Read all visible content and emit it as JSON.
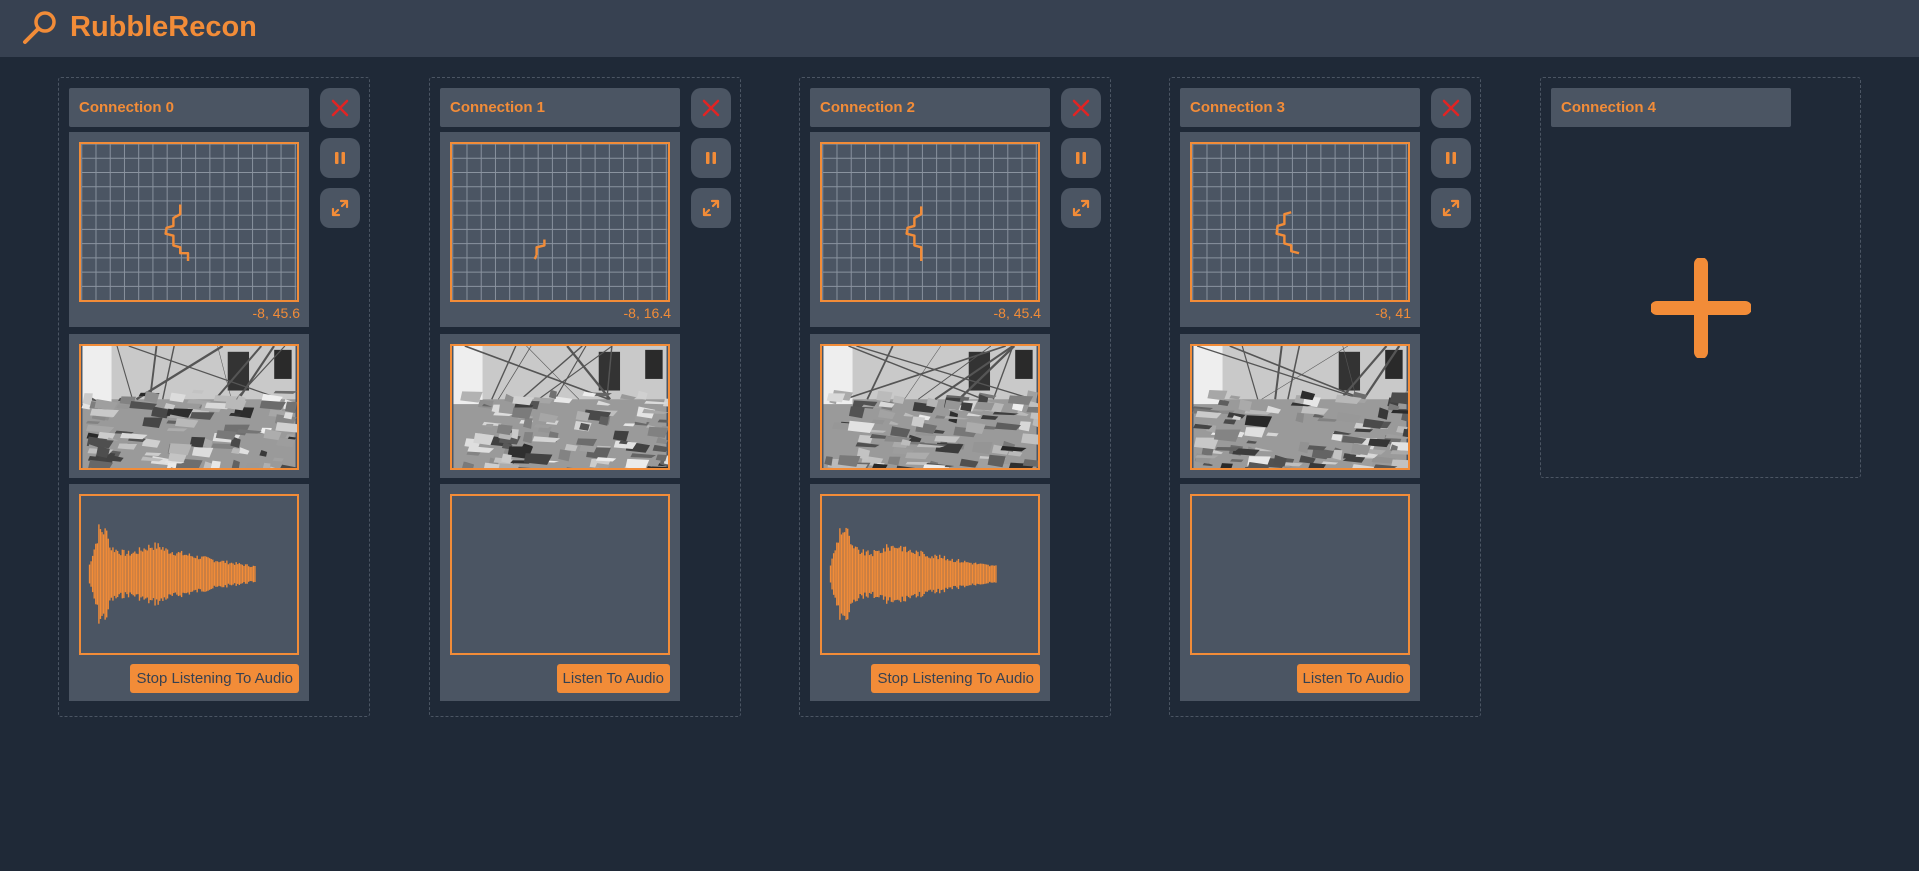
{
  "app": {
    "title": "RubbleRecon",
    "logo_icon": "magnifier-icon",
    "accent_color": "#f28c38",
    "danger_color": "#e02424"
  },
  "connections": [
    {
      "title": "Connection 0",
      "coords": "-8, 45.6",
      "audio_button": "Stop Listening To Audio",
      "audio_active": true
    },
    {
      "title": "Connection 1",
      "coords": "-8, 16.4",
      "audio_button": "Listen To Audio",
      "audio_active": false
    },
    {
      "title": "Connection 2",
      "coords": "-8, 45.4",
      "audio_button": "Stop Listening To Audio",
      "audio_active": true
    },
    {
      "title": "Connection 3",
      "coords": "-8, 41",
      "audio_button": "Listen To Audio",
      "audio_active": false
    }
  ],
  "add_connection": {
    "title": "Connection 4",
    "icon": "plus-icon"
  },
  "controls": {
    "close_icon": "close-icon",
    "pause_icon": "pause-icon",
    "expand_icon": "expand-icon"
  }
}
